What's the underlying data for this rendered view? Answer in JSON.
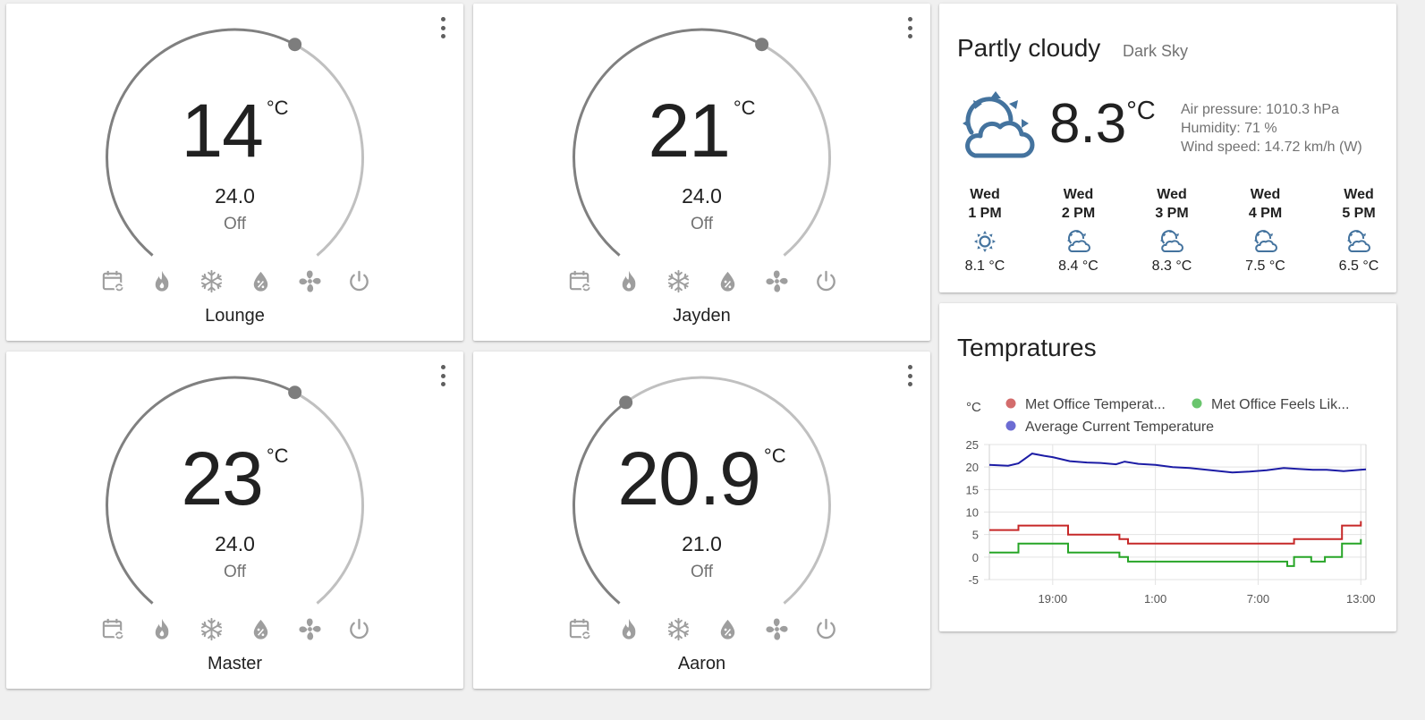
{
  "thermostats": [
    {
      "name": "Lounge",
      "current": "14",
      "unit": "°C",
      "target": "24.0",
      "state": "Off",
      "level": 0.6
    },
    {
      "name": "Jayden",
      "current": "21",
      "unit": "°C",
      "target": "24.0",
      "state": "Off",
      "level": 0.6
    },
    {
      "name": "Master",
      "current": "23",
      "unit": "°C",
      "target": "24.0",
      "state": "Off",
      "level": 0.6
    },
    {
      "name": "Aaron",
      "current": "20.9",
      "unit": "°C",
      "target": "21.0",
      "state": "Off",
      "level": 0.37
    }
  ],
  "thermostat_modes": [
    "calendar-sync-icon",
    "fire-icon",
    "snowflake-icon",
    "water-percent-icon",
    "fan-icon",
    "power-icon"
  ],
  "weather": {
    "condition": "Partly cloudy",
    "source": "Dark Sky",
    "temperature": "8.3",
    "unit": "°C",
    "air_pressure": "Air pressure: 1010.3 hPa",
    "humidity": "Humidity: 71 %",
    "wind_speed": "Wind speed: 14.72 km/h (W)",
    "icon_color": "#44739e",
    "forecast": [
      {
        "day": "Wed",
        "time": "1 PM",
        "temp": "8.1 °C",
        "icon": "sunny-icon"
      },
      {
        "day": "Wed",
        "time": "2 PM",
        "temp": "8.4 °C",
        "icon": "partly-cloudy-icon"
      },
      {
        "day": "Wed",
        "time": "3 PM",
        "temp": "8.3 °C",
        "icon": "partly-cloudy-icon"
      },
      {
        "day": "Wed",
        "time": "4 PM",
        "temp": "7.5 °C",
        "icon": "partly-cloudy-icon"
      },
      {
        "day": "Wed",
        "time": "5 PM",
        "temp": "6.5 °C",
        "icon": "partly-cloudy-icon"
      }
    ]
  },
  "temps_card": {
    "title": "Tempratures"
  },
  "chart_data": {
    "type": "line",
    "title": "Tempratures",
    "ylabel": "°C",
    "ylim": [
      -5,
      25
    ],
    "yticks": [
      25,
      20,
      15,
      10,
      5,
      0,
      -5
    ],
    "xlim": [
      15.3,
      37.3
    ],
    "xticks": [
      {
        "v": 19,
        "label": "19:00"
      },
      {
        "v": 25,
        "label": "1:00"
      },
      {
        "v": 31,
        "label": "7:00"
      },
      {
        "v": 37,
        "label": "13:00"
      }
    ],
    "grid": true,
    "legend_position": "top",
    "series": [
      {
        "name": "Met Office Temperat...",
        "color": "#c62828",
        "legend_color": "#d36c6c",
        "step": true,
        "x": [
          15.3,
          17,
          19.9,
          22.9,
          23.4,
          33.1,
          35.9,
          37
        ],
        "y": [
          6,
          7,
          5,
          4,
          3,
          4,
          7,
          8
        ]
      },
      {
        "name": "Met Office Feels Lik...",
        "color": "#27a527",
        "legend_color": "#69c56d",
        "step": true,
        "x": [
          15.3,
          17,
          19.9,
          22.9,
          23.4,
          32.7,
          33.1,
          34.1,
          34.9,
          35.9,
          37
        ],
        "y": [
          1,
          3,
          1,
          0,
          -1,
          -2,
          0,
          -1,
          0,
          3,
          4
        ]
      },
      {
        "name": "Average Current Temperature",
        "color": "#1c1ca5",
        "legend_color": "#6c6cd3",
        "step": false,
        "x": [
          15.3,
          16.4,
          17,
          17.8,
          18.5,
          19,
          20,
          21,
          21.8,
          22.7,
          23.2,
          24,
          25,
          26,
          27,
          28,
          29.5,
          30.5,
          31.5,
          32.5,
          33.3,
          34.2,
          35,
          36,
          37.3
        ],
        "y": [
          20.5,
          20.3,
          20.8,
          23,
          22.5,
          22.2,
          21.3,
          21,
          20.9,
          20.6,
          21.2,
          20.7,
          20.5,
          20,
          19.8,
          19.4,
          18.8,
          19,
          19.3,
          19.8,
          19.6,
          19.4,
          19.4,
          19.1,
          19.5
        ]
      }
    ]
  }
}
